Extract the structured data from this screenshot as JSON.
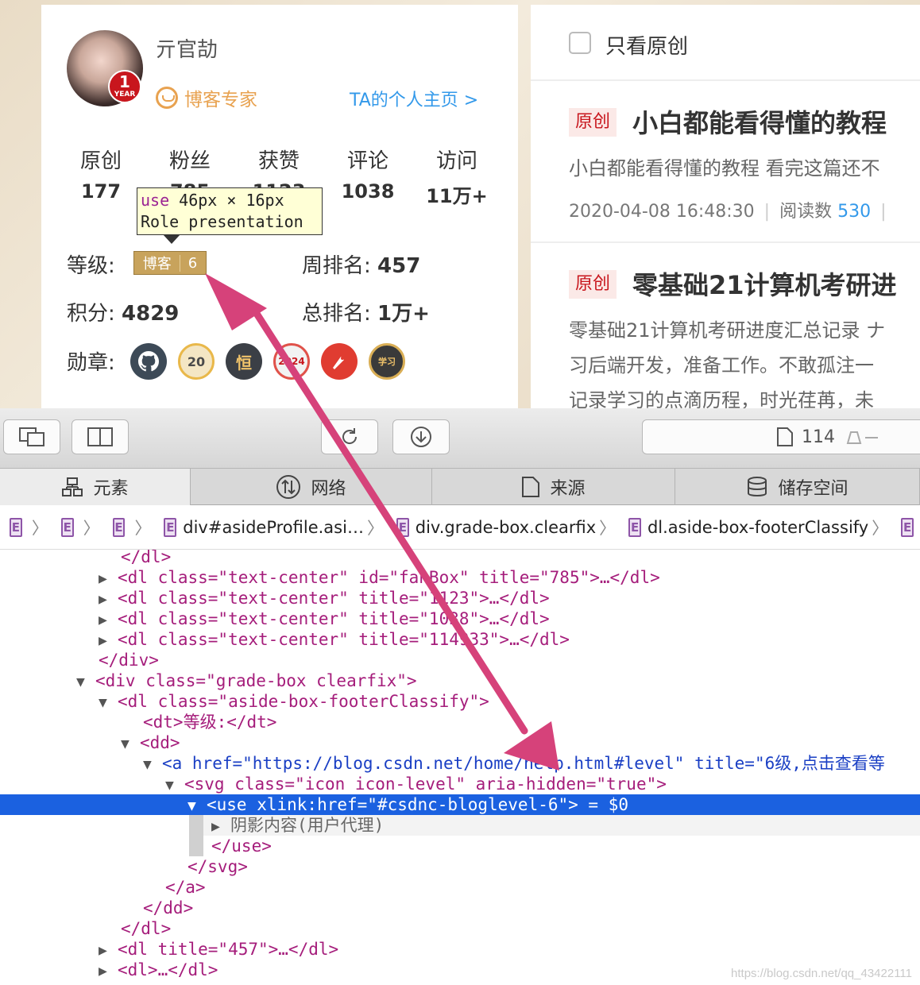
{
  "profile": {
    "username": "亓官劼",
    "year_badge": {
      "number": "1",
      "label": "YEAR"
    },
    "expert_label": "博客专家",
    "homepage_link": "TA的个人主页 >",
    "stats": [
      {
        "label": "原创",
        "value": "177"
      },
      {
        "label": "粉丝",
        "value": "785"
      },
      {
        "label": "获赞",
        "value": "1123"
      },
      {
        "label": "评论",
        "value": "1038"
      },
      {
        "label": "访问",
        "value": "11万+"
      }
    ],
    "level_label": "等级:",
    "level_badge": {
      "text": "博客",
      "level": "6"
    },
    "weekly_rank_label": "周排名:",
    "weekly_rank": "457",
    "points_label": "积分:",
    "points": "4829",
    "total_rank_label": "总排名:",
    "total_rank": "1万+",
    "medals_label": "勋章:",
    "medals": [
      {
        "icon": "github-medal-icon",
        "text": "",
        "color": "#3d4a57"
      },
      {
        "icon": "year-20-medal-icon",
        "text": "20",
        "color": "#f4e6c4"
      },
      {
        "icon": "persistence-medal-icon",
        "text": "恒",
        "color": "#3b3f46"
      },
      {
        "icon": "2024-medal-icon",
        "text": "2024",
        "color": "#f2f2f2"
      },
      {
        "icon": "pen-medal-icon",
        "text": "",
        "color": "#e03c31"
      },
      {
        "icon": "study-medal-icon",
        "text": "学习",
        "color": "#3a3a3a"
      }
    ]
  },
  "tooltip": {
    "line1_tag": "use",
    "line1_size": "46px × 16px",
    "line2_key": "Role",
    "line2_value": "presentation"
  },
  "articles_panel": {
    "only_original_label": "只看原创",
    "articles": [
      {
        "tag": "原创",
        "title": "小白都能看得懂的教程",
        "desc_lines": [
          "小白都能看得懂的教程 看完这篇还不"
        ],
        "date": "2020-04-08 16:48:30",
        "reads_label": "阅读数",
        "reads": "530"
      },
      {
        "tag": "原创",
        "title": "零基础21计算机考研进",
        "desc_lines": [
          "零基础21计算机考研进度汇总记录 ナ",
          "习后端开发，准备工作。不敢孤注一",
          "记录学习的点滴历程，时光荏苒，未"
        ]
      }
    ]
  },
  "devtools": {
    "toolbar": {
      "resource_count": "114"
    },
    "tabs": [
      {
        "icon": "elements-icon",
        "label": "元素"
      },
      {
        "icon": "network-icon",
        "label": "网络"
      },
      {
        "icon": "sources-icon",
        "label": "来源"
      },
      {
        "icon": "storage-icon",
        "label": "储存空间"
      }
    ],
    "breadcrumbs": [
      "E",
      "E",
      "E",
      "div#asideProfile.asi…",
      "div.grade-box.clearfix",
      "dl.aside-box-footerClassify"
    ],
    "code_lines": [
      {
        "indent": 0,
        "text": "</dl>"
      },
      {
        "text": "<dl class=\"text-center\" id=\"fanBox\" title=\"785\">…</dl>"
      },
      {
        "text": "<dl class=\"text-center\" title=\"1123\">…</dl>"
      },
      {
        "text": "<dl class=\"text-center\" title=\"1038\">…</dl>"
      },
      {
        "text": "<dl class=\"text-center\" title=\"114933\">…</dl>"
      },
      {
        "text": "</div>"
      },
      {
        "text": "<div class=\"grade-box clearfix\">"
      },
      {
        "text": "<dl class=\"aside-box-footerClassify\">"
      },
      {
        "text": "<dt>等级:</dt>"
      },
      {
        "text": "<dd>"
      },
      {
        "text": "<a href=\"https://blog.csdn.net/home/help.html#level\" title=\"6级,点击查看等"
      },
      {
        "text": "<svg class=\"icon icon-level\" aria-hidden=\"true\">"
      },
      {
        "text": "<use xlink:href=\"#csdnc-bloglevel-6\"> = $0"
      },
      {
        "text": "阴影内容(用户代理)"
      },
      {
        "text": "</use>"
      },
      {
        "text": "</svg>"
      },
      {
        "text": "</a>"
      },
      {
        "text": "</dd>"
      },
      {
        "text": "</dl>"
      },
      {
        "text": "<dl title=\"457\">…</dl>"
      },
      {
        "text": "<dl>…</dl>"
      }
    ]
  },
  "watermark": "https://blog.csdn.net/qq_43422111",
  "colors": {
    "annotation_arrow": "#d6427a",
    "selection": "#1b61e0",
    "accent": "#3399ea"
  }
}
